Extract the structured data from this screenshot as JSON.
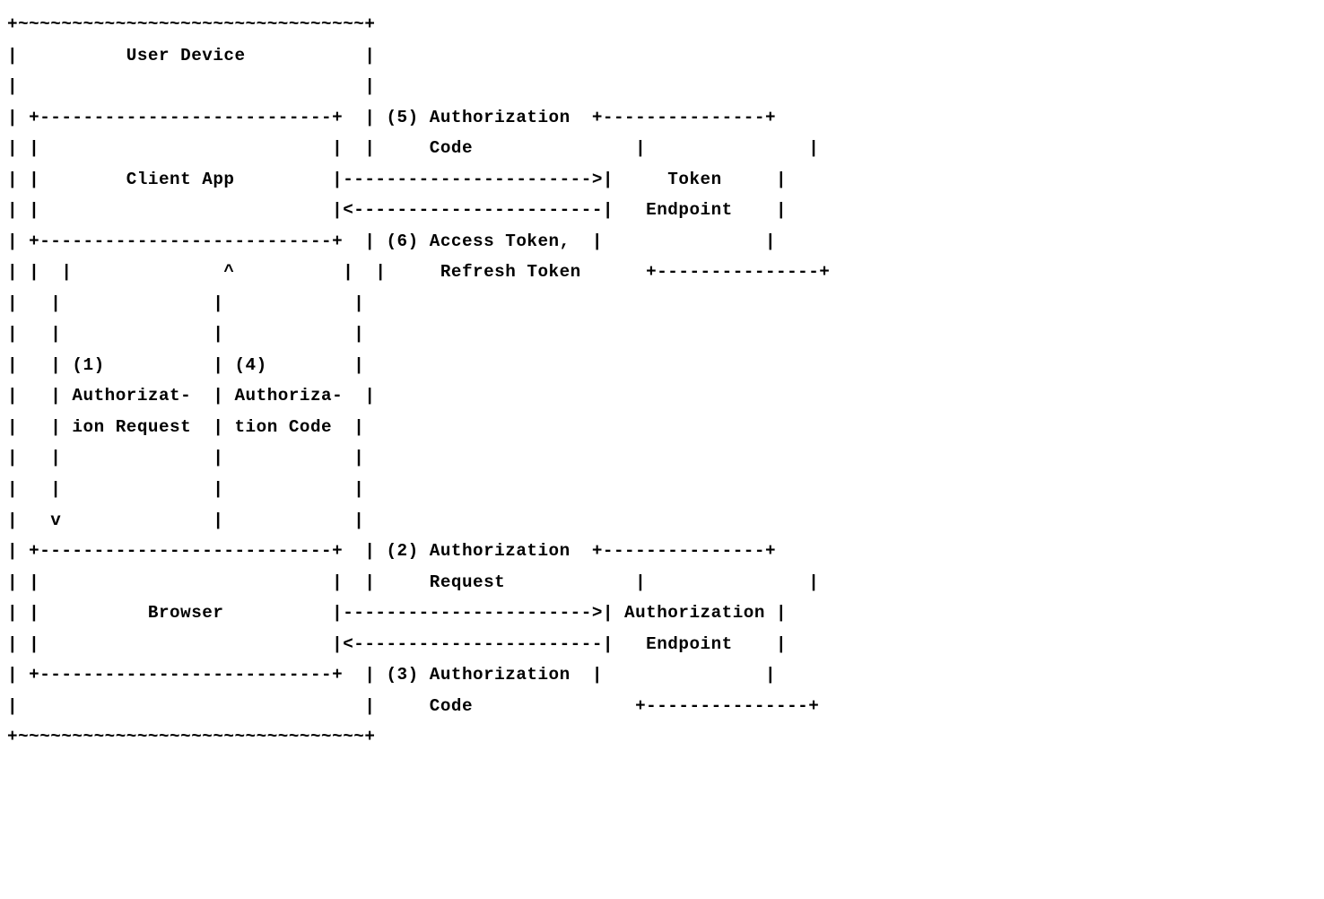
{
  "diagram": {
    "type": "ascii-flow",
    "entities": {
      "user_device": "User Device",
      "client_app": "Client App",
      "browser": "Browser",
      "token_endpoint_l1": "Token",
      "token_endpoint_l2": "Endpoint",
      "authz_endpoint_l1": "Authorization",
      "authz_endpoint_l2": "Endpoint"
    },
    "flows": {
      "f1_l1": "(1)",
      "f1_l2": "Authorizat-",
      "f1_l3": "ion Request",
      "f4_l1": "(4)",
      "f4_l2": "Authoriza-",
      "f4_l3": "tion Code",
      "f5_l1": "(5) Authorization",
      "f5_l2": "    Code",
      "f6_l1": "(6) Access Token,",
      "f6_l2": "    Refresh Token",
      "f2_l1": "(2) Authorization",
      "f2_l2": "    Request",
      "f3_l1": "(3) Authorization",
      "f3_l2": "    Code"
    },
    "lines": [
      "+~~~~~~~~~~~~~~~~~~~~~~~~~~~~~~~~+",
      "|          %user_device%           |",
      "|                                |",
      "| +---------------------------+  | %f5_l1%  +---------------+",
      "| |                           |  | %f5_l2%               |               |",
      "| |        %client_app%         |----------------------->|     %token_endpoint_l1%     |",
      "| |                           |<-----------------------|   %token_endpoint_l2%    |",
      "| +---------------------------+  | %f6_l1%  |               |",
      "| |  |              ^          |  | %f6_l2%      +---------------+",
      "|   |              |            |",
      "|   |              |            |",
      "|   | %f1_l1%          | %f4_l1%        |",
      "|   | %f1_l2%  | %f4_l2%  |",
      "|   | %f1_l3%  | %f4_l3%  |",
      "|   |              |            |",
      "|   |              |            |",
      "|   v              |            |",
      "| +---------------------------+  | %f2_l1%  +---------------+",
      "| |                           |  | %f2_l2%            |               |",
      "| |          %browser%          |----------------------->| %authz_endpoint_l1% |",
      "| |                           |<-----------------------|   %authz_endpoint_l2%    |",
      "| +---------------------------+  | %f3_l1%  |               |",
      "|                                | %f3_l2%               +---------------+",
      "+~~~~~~~~~~~~~~~~~~~~~~~~~~~~~~~~+"
    ]
  }
}
